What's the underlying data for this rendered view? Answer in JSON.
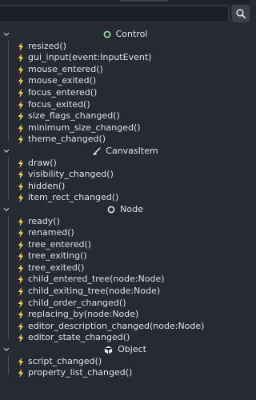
{
  "search": {
    "placeholder": ""
  },
  "groups": [
    {
      "name": "Control",
      "icon": "control-icon",
      "signals": [
        "resized()",
        "gui_input(event:InputEvent)",
        "mouse_entered()",
        "mouse_exited()",
        "focus_entered()",
        "focus_exited()",
        "size_flags_changed()",
        "minimum_size_changed()",
        "theme_changed()"
      ]
    },
    {
      "name": "CanvasItem",
      "icon": "canvasitem-icon",
      "signals": [
        "draw()",
        "visibility_changed()",
        "hidden()",
        "item_rect_changed()"
      ]
    },
    {
      "name": "Node",
      "icon": "node-icon",
      "signals": [
        "ready()",
        "renamed()",
        "tree_entered()",
        "tree_exiting()",
        "tree_exited()",
        "child_entered_tree(node:Node)",
        "child_exiting_tree(node:Node)",
        "child_order_changed()",
        "replacing_by(node:Node)",
        "editor_description_changed(node:Node)",
        "editor_state_changed()"
      ]
    },
    {
      "name": "Object",
      "icon": "object-icon",
      "signals": [
        "script_changed()",
        "property_list_changed()"
      ]
    }
  ],
  "colors": {
    "control": "#8eef97",
    "bolt": "#ffd343",
    "background": "#252a33"
  }
}
